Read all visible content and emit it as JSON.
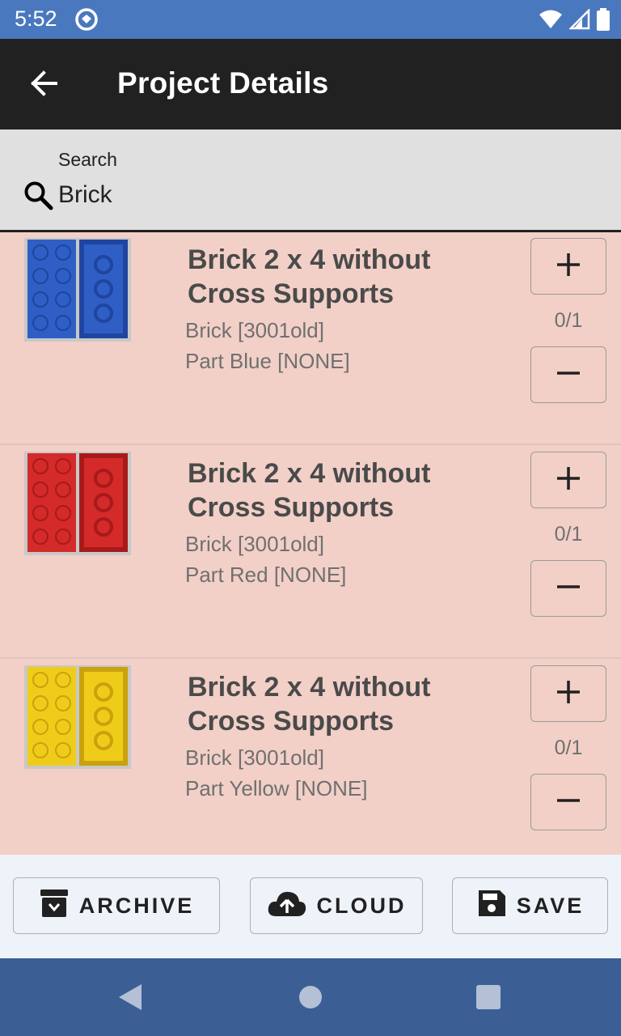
{
  "status_bar": {
    "time": "5:52"
  },
  "app_bar": {
    "title": "Project Details"
  },
  "search": {
    "label": "Search",
    "value": "Brick"
  },
  "items": [
    {
      "name": "Brick 2 x 4 without Cross Supports",
      "category": "Brick [3001old]",
      "color": "Part Blue [NONE]",
      "count": "0/1",
      "brick_color": "#2f5fc4",
      "brick_dark": "#1f45a0"
    },
    {
      "name": "Brick 2 x 4 without Cross Supports",
      "category": "Brick [3001old]",
      "color": "Part Red [NONE]",
      "count": "0/1",
      "brick_color": "#d42a2a",
      "brick_dark": "#a81a1a"
    },
    {
      "name": "Brick 2 x 4 without Cross Supports",
      "category": "Brick [3001old]",
      "color": "Part Yellow [NONE]",
      "count": "0/1",
      "brick_color": "#f0cc1a",
      "brick_dark": "#c9a20c"
    }
  ],
  "actions": {
    "archive": "ARCHIVE",
    "cloud": "CLOUD",
    "save": "SAVE"
  },
  "colors": {
    "status_bar": "#4a78be",
    "app_bar": "#212121",
    "list_bg": "#f2d0c7",
    "nav_bar": "#3b5f95"
  }
}
